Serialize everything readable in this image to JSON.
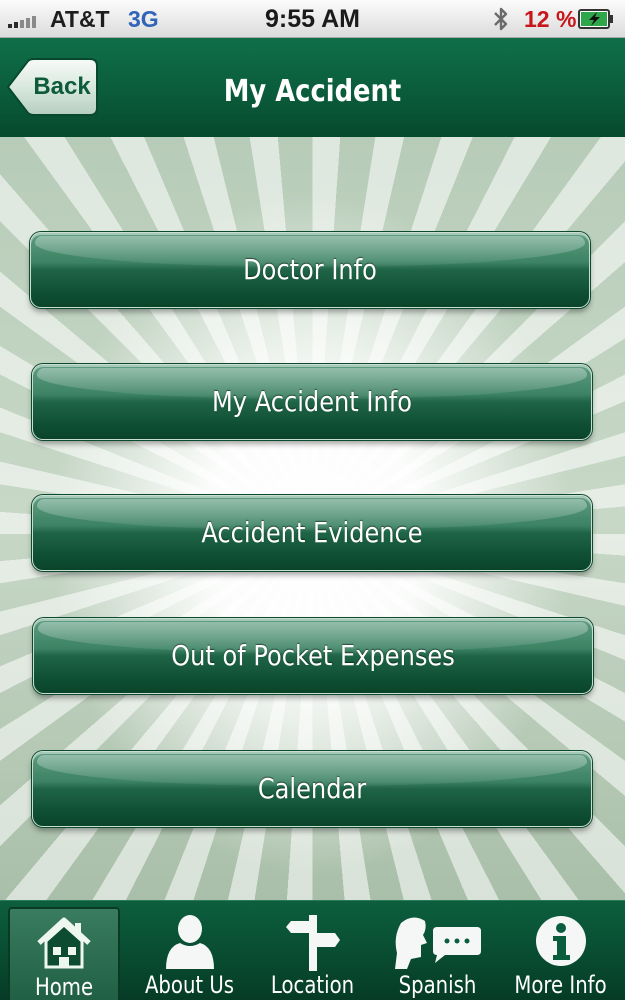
{
  "status_bar": {
    "carrier": "AT&T",
    "network": "3G",
    "time": "9:55 AM",
    "battery_percent": "12 %"
  },
  "nav": {
    "back_label": "Back",
    "title": "My Accident"
  },
  "menu": {
    "items": [
      {
        "label": "Doctor Info"
      },
      {
        "label": "My Accident Info"
      },
      {
        "label": "Accident Evidence"
      },
      {
        "label": "Out of Pocket Expenses"
      },
      {
        "label": "Calendar"
      }
    ]
  },
  "tabs": {
    "items": [
      {
        "label": "Home",
        "icon": "home-icon",
        "active": true
      },
      {
        "label": "About Us",
        "icon": "person-icon",
        "active": false
      },
      {
        "label": "Location",
        "icon": "signpost-icon",
        "active": false
      },
      {
        "label": "Spanish",
        "icon": "speech-icon",
        "active": false
      },
      {
        "label": "More Info",
        "icon": "info-icon",
        "active": false
      }
    ]
  },
  "colors": {
    "brand_green": "#0b5e3d",
    "battery_warning": "#c8161b",
    "network_blue": "#2f64b8"
  }
}
